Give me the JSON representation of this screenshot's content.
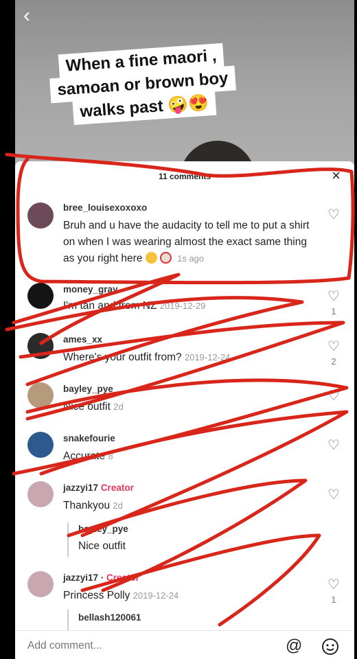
{
  "video": {
    "caption": [
      "When a fine maori ,",
      "samoan or brown boy",
      "walks past 🤪😍"
    ],
    "back_icon": "chevron-left-icon"
  },
  "sheet": {
    "title": "11 comments",
    "close_symbol": "×"
  },
  "comments": [
    {
      "user": "bree_louisexoxoxo",
      "text": "Bruh and u have the audacity to tell me to put a shirt on when I was wearing almost the exact same thing as you right here",
      "time": "1s ago",
      "avatar_color": "#6d4a5a"
    },
    {
      "user": "money_gray",
      "text": "I'm tan and from NZ",
      "time": "2019-12-29",
      "likes": "1",
      "avatar_color": "#141414"
    },
    {
      "user": "ames_xx",
      "text": "Where's your outfit from?",
      "time": "2019-12-24",
      "likes": "2",
      "avatar_color": "#2b2b2b"
    },
    {
      "user": "bayley_pye",
      "text": "Nice outfit",
      "time": "2d",
      "avatar_color": "#b59a7c"
    },
    {
      "user": "snakefourie",
      "text": "Accurate",
      "time": "8",
      "avatar_color": "#2d5a8c"
    },
    {
      "user": "jazzyi17",
      "creator": "Creator",
      "text": "Thankyou",
      "time": "2d",
      "avatar_color": "#c9a7b0",
      "reply": {
        "user": "bayley_pye",
        "text": "Nice outfit"
      }
    },
    {
      "user": "jazzyi17 ·",
      "creator": "Creator",
      "text": "Princess Polly",
      "time": "2019-12-24",
      "likes": "1",
      "avatar_color": "#c9a7b0",
      "reply": {
        "user": "bellash120061",
        "text": ""
      }
    }
  ],
  "input": {
    "placeholder": "Add comment..."
  },
  "colors": {
    "scribble": "#d8261b",
    "creator": "#e8355a"
  }
}
